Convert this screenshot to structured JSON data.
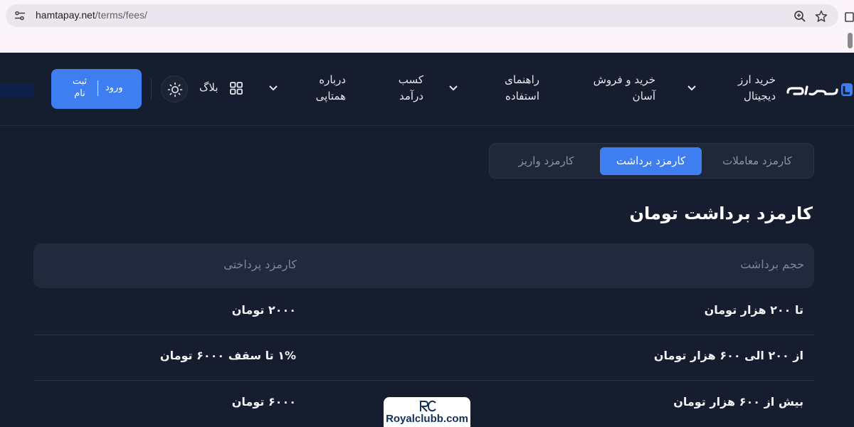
{
  "browser": {
    "url_domain": "hamtapay.net",
    "url_path": "/terms/fees/",
    "icons": [
      "tune-icon",
      "zoom-icon",
      "star-icon",
      "extension-icon"
    ]
  },
  "header": {
    "logo_text": "همتاپی",
    "nav": [
      {
        "line1": "خرید ارز",
        "line2": "دیجیتال",
        "has_dropdown": true
      },
      {
        "line1": "خرید و فروش",
        "line2": "آسان",
        "has_dropdown": true
      },
      {
        "line1": "راهنمای",
        "line2": "استفاده",
        "has_dropdown": true
      },
      {
        "line1": "کسب",
        "line2": "درآمد",
        "has_dropdown": false
      },
      {
        "line1": "درباره",
        "line2": "همتاپی",
        "has_dropdown": true
      }
    ],
    "blog_label": "بلاگ",
    "login_label": "ورود",
    "signup_line1": "ثبت",
    "signup_line2": "نام"
  },
  "tabs": [
    {
      "label": "کارمزد معاملات",
      "active": false
    },
    {
      "label": "کارمزد برداشت",
      "active": true
    },
    {
      "label": "کارمزد واریز",
      "active": false
    }
  ],
  "section_title": "کارمزد برداشت تومان",
  "table": {
    "headers": [
      "حجم برداشت",
      "کارمزد پرداختی"
    ],
    "rows": [
      [
        "تا ۲۰۰ هزار تومان",
        "۲۰۰۰ تومان"
      ],
      [
        "از ۲۰۰ الی ۶۰۰ هزار تومان",
        "۱% تا سقف ۶۰۰۰ تومان"
      ],
      [
        "بیش از ۶۰۰ هزار تومان",
        "۶۰۰۰ تومان"
      ]
    ]
  },
  "watermark": {
    "mark": "RC",
    "text": "Royalclubb.com"
  },
  "colors": {
    "accent": "#3f7ef0",
    "background": "#161d2e",
    "panel": "#212a3c"
  }
}
